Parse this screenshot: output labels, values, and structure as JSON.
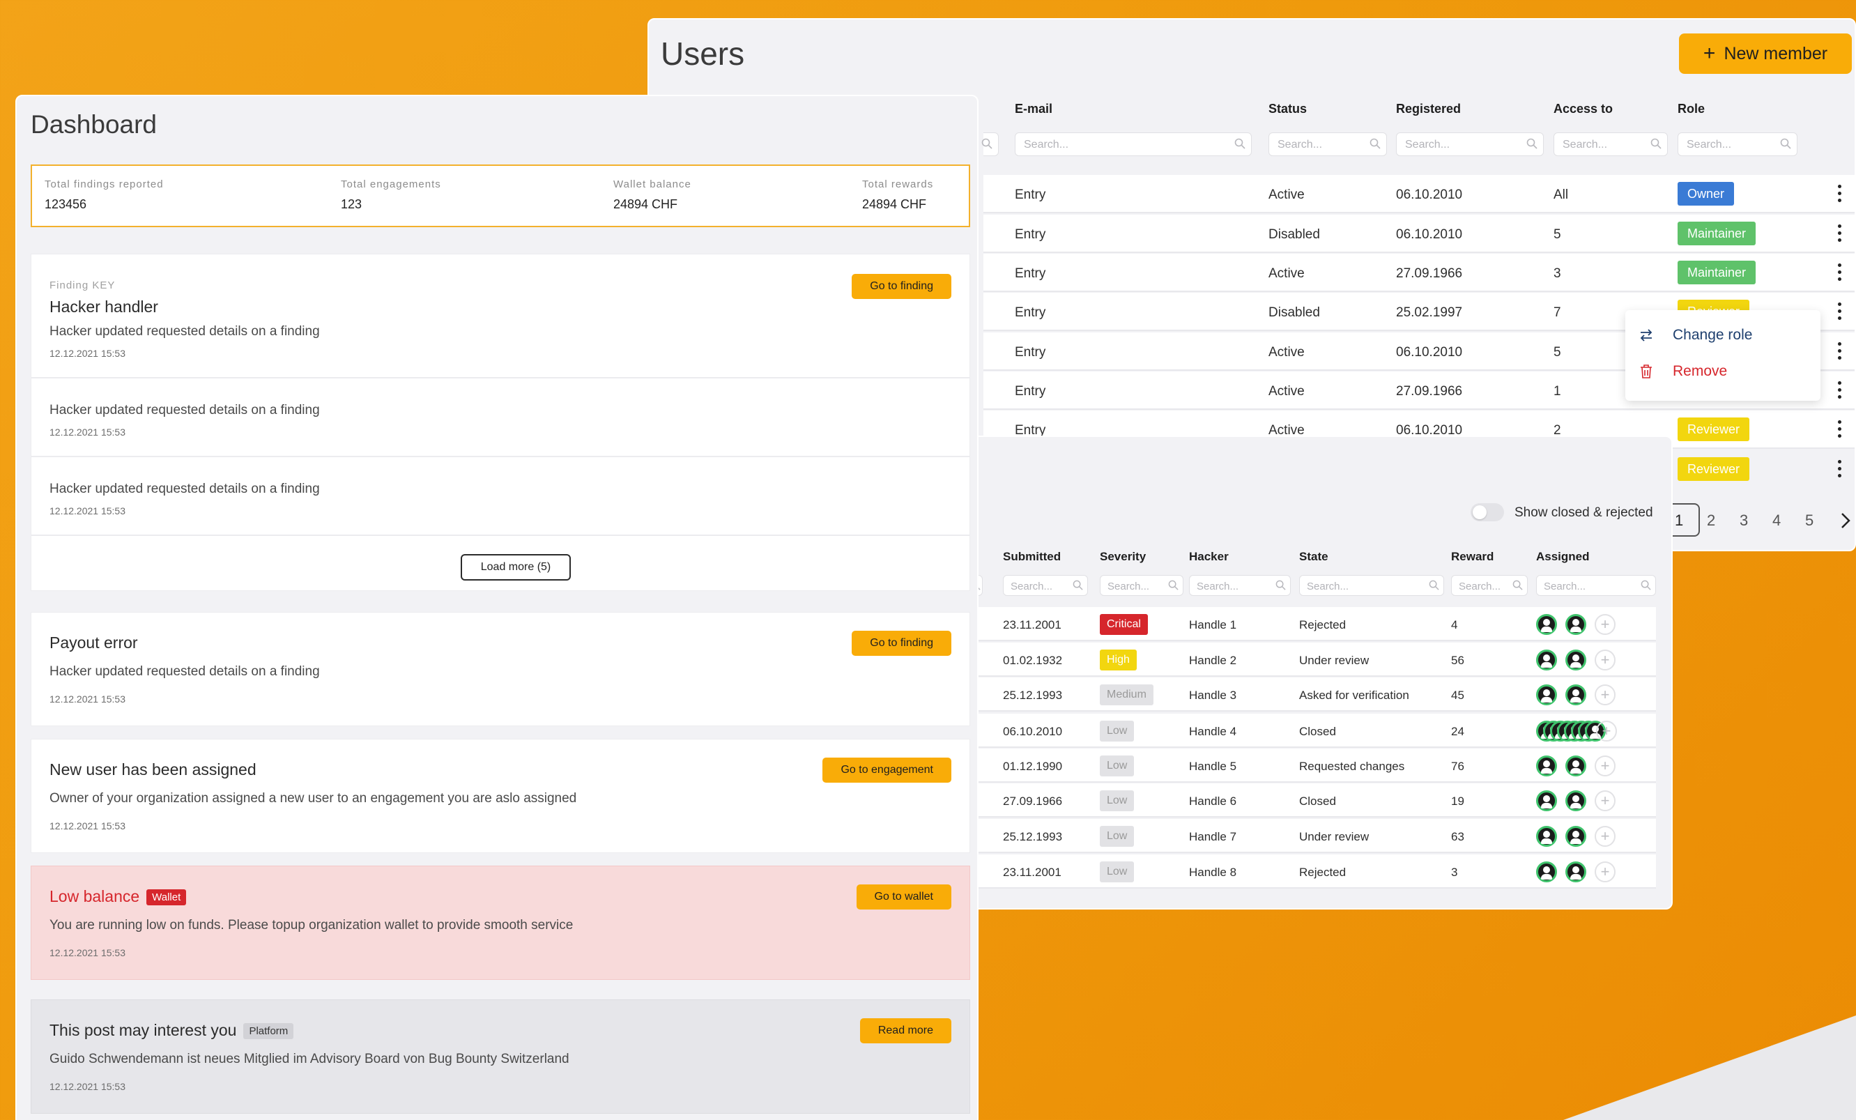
{
  "users": {
    "title": "Users",
    "new_member_label": "New member",
    "columns": [
      "E-mail",
      "Status",
      "Registered",
      "Access to",
      "Role"
    ],
    "search_placeholder": "Search...",
    "rows": [
      {
        "email": "Entry",
        "status": "Active",
        "registered": "06.10.2010",
        "access": "All",
        "role": "Owner",
        "role_type": "owner"
      },
      {
        "email": "Entry",
        "status": "Disabled",
        "registered": "06.10.2010",
        "access": "5",
        "role": "Maintainer",
        "role_type": "maint"
      },
      {
        "email": "Entry",
        "status": "Active",
        "registered": "27.09.1966",
        "access": "3",
        "role": "Maintainer",
        "role_type": "maint"
      },
      {
        "email": "Entry",
        "status": "Disabled",
        "registered": "25.02.1997",
        "access": "7",
        "role": "Reviewer",
        "role_type": "rev"
      },
      {
        "email": "Entry",
        "status": "Active",
        "registered": "06.10.2010",
        "access": "5",
        "role": "",
        "role_type": ""
      },
      {
        "email": "Entry",
        "status": "Active",
        "registered": "27.09.1966",
        "access": "1",
        "role": "",
        "role_type": ""
      },
      {
        "email": "Entry",
        "status": "Active",
        "registered": "06.10.2010",
        "access": "2",
        "role": "Reviewer",
        "role_type": "rev"
      },
      {
        "email": "",
        "status": "",
        "registered": "",
        "access": "",
        "role": "Reviewer",
        "role_type": "rev"
      }
    ],
    "pages": [
      "1",
      "2",
      "3",
      "4",
      "5"
    ],
    "current_page": "1"
  },
  "context_menu": {
    "change_role": "Change role",
    "remove": "Remove"
  },
  "findings": {
    "toggle_label": "Show closed & rejected",
    "columns": [
      "Submitted",
      "Severity",
      "Hacker",
      "State",
      "Reward",
      "Assigned"
    ],
    "search_placeholder": "Search...",
    "rows": [
      {
        "submitted": "23.11.2001",
        "severity": "Critical",
        "sev_type": "critical",
        "hacker": "Handle 1",
        "state": "Rejected",
        "reward": "4"
      },
      {
        "submitted": "01.02.1932",
        "severity": "High",
        "sev_type": "high",
        "hacker": "Handle 2",
        "state": "Under review",
        "reward": "56"
      },
      {
        "submitted": "25.12.1993",
        "severity": "Medium",
        "sev_type": "medium",
        "hacker": "Handle 3",
        "state": "Asked for verification",
        "reward": "45"
      },
      {
        "submitted": "06.10.2010",
        "severity": "Low",
        "sev_type": "low",
        "hacker": "Handle 4",
        "state": "Closed",
        "reward": "24"
      },
      {
        "submitted": "01.12.1990",
        "severity": "Low",
        "sev_type": "low",
        "hacker": "Handle 5",
        "state": "Requested changes",
        "reward": "76"
      },
      {
        "submitted": "27.09.1966",
        "severity": "Low",
        "sev_type": "low",
        "hacker": "Handle 6",
        "state": "Closed",
        "reward": "19"
      },
      {
        "submitted": "25.12.1993",
        "severity": "Low",
        "sev_type": "low",
        "hacker": "Handle 7",
        "state": "Under review",
        "reward": "63"
      },
      {
        "submitted": "23.11.2001",
        "severity": "Low",
        "sev_type": "low",
        "hacker": "Handle 8",
        "state": "Rejected",
        "reward": "3"
      }
    ]
  },
  "dashboard": {
    "title": "Dashboard",
    "stats": [
      {
        "label": "Total findings reported",
        "value": "123456"
      },
      {
        "label": "Total engagements",
        "value": "123"
      },
      {
        "label": "Wallet balance",
        "value": "24894 CHF"
      },
      {
        "label": "Total rewards",
        "value": "24894 CHF"
      }
    ],
    "finding_card": {
      "key_label": "Finding KEY",
      "title": "Hacker handler",
      "button": "Go to finding",
      "items": [
        {
          "text": "Hacker updated requested details on a finding",
          "time": "12.12.2021 15:53"
        },
        {
          "text": "Hacker updated requested details on a finding",
          "time": "12.12.2021 15:53"
        },
        {
          "text": "Hacker updated requested details on a finding",
          "time": "12.12.2021 15:53"
        }
      ],
      "load_more": "Load more (5)"
    },
    "payout_card": {
      "title": "Payout error",
      "text": "Hacker updated requested details on a finding",
      "time": "12.12.2021 15:53",
      "button": "Go to finding"
    },
    "assign_card": {
      "title": "New user has been assigned",
      "text": "Owner of your organization assigned a new user to an engagement you are aslo assigned",
      "time": "12.12.2021 15:53",
      "button": "Go to engagement"
    },
    "balance_card": {
      "title": "Low balance",
      "tag": "Wallet",
      "text": "You are running low on funds. Please topup organization wallet to provide smooth service",
      "time": "12.12.2021 15:53",
      "button": "Go to wallet"
    },
    "post_card": {
      "title": "This post may interest you",
      "tag": "Platform",
      "text": "Guido Schwendemann ist neues Mitglied im Advisory Board von Bug Bounty Switzerland",
      "time": "12.12.2021 15:53",
      "button": "Read more"
    }
  },
  "colors": {
    "accent": "#f9ac08",
    "critical": "#d6262c",
    "owner": "#3a7bd5",
    "maintainer": "#5fc26a",
    "reviewer": "#f2d60f"
  }
}
